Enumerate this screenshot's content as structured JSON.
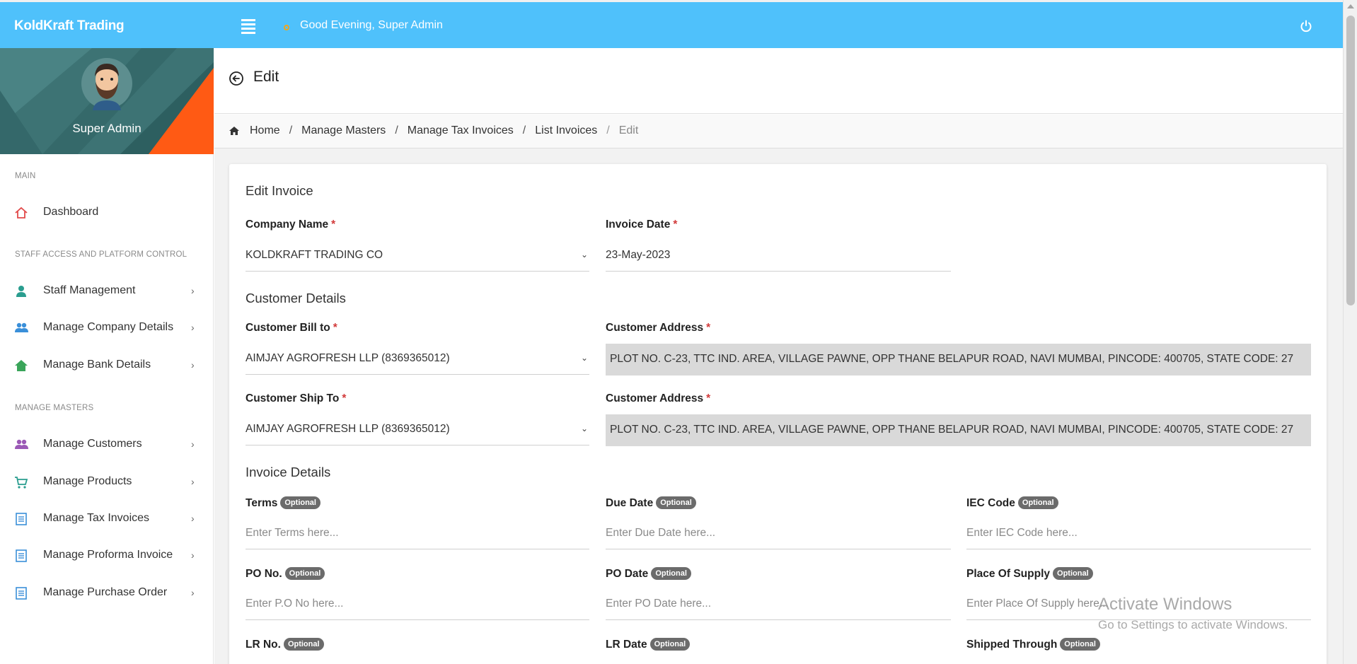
{
  "app": {
    "brand": "KoldKraft Trading",
    "greeting": "Good Evening, Super Admin"
  },
  "sidebar": {
    "profile_name": "Super Admin",
    "sections": [
      "MAIN",
      "STAFF ACCESS AND PLATFORM CONTROL",
      "MANAGE MASTERS"
    ],
    "items": [
      {
        "label": "Dashboard",
        "icon": "home-icon",
        "color": "#e24a4a"
      },
      {
        "label": "Staff Management",
        "icon": "user-icon",
        "color": "#2a9d8f"
      },
      {
        "label": "Manage Company Details",
        "icon": "users-icon",
        "color": "#3a8fd9"
      },
      {
        "label": "Manage Bank Details",
        "icon": "bank-home-icon",
        "color": "#3aa55a"
      },
      {
        "label": "Manage Customers",
        "icon": "customers-icon",
        "color": "#9b59b6"
      },
      {
        "label": "Manage Products",
        "icon": "cart-icon",
        "color": "#2a9d8f"
      },
      {
        "label": "Manage Tax Invoices",
        "icon": "document-icon",
        "color": "#3a8fd9"
      },
      {
        "label": "Manage Proforma Invoice",
        "icon": "document-icon",
        "color": "#3a8fd9"
      },
      {
        "label": "Manage Purchase Order",
        "icon": "document-icon",
        "color": "#3a8fd9"
      }
    ]
  },
  "page": {
    "title": "Edit",
    "breadcrumb": [
      "Home",
      "Manage Masters",
      "Manage Tax Invoices",
      "List Invoices",
      "Edit"
    ]
  },
  "form": {
    "card_title": "Edit Invoice",
    "company_name": {
      "label": "Company Name",
      "required": "*",
      "value": "KOLDKRAFT TRADING CO"
    },
    "invoice_date": {
      "label": "Invoice Date",
      "required": "*",
      "value": "23-May-2023"
    },
    "customer_details_title": "Customer Details",
    "bill_to": {
      "label": "Customer Bill to",
      "required": "*",
      "value": "AIMJAY AGROFRESH LLP (8369365012)"
    },
    "bill_address": {
      "label": "Customer Address",
      "required": "*",
      "value": "PLOT NO. C-23, TTC IND. AREA, VILLAGE PAWNE, OPP THANE BELAPUR ROAD, NAVI MUMBAI, PINCODE: 400705, STATE CODE: 27"
    },
    "ship_to": {
      "label": "Customer Ship To",
      "required": "*",
      "value": "AIMJAY AGROFRESH LLP (8369365012)"
    },
    "ship_address": {
      "label": "Customer Address",
      "required": "*",
      "value": "PLOT NO. C-23, TTC IND. AREA, VILLAGE PAWNE, OPP THANE BELAPUR ROAD, NAVI MUMBAI, PINCODE: 400705, STATE CODE: 27"
    },
    "invoice_details_title": "Invoice Details",
    "optional_badge": "Optional",
    "terms": {
      "label": "Terms",
      "placeholder": "Enter Terms here..."
    },
    "due_date": {
      "label": "Due Date",
      "placeholder": "Enter Due Date here..."
    },
    "iec_code": {
      "label": "IEC Code",
      "placeholder": "Enter IEC Code here..."
    },
    "po_no": {
      "label": "PO No.",
      "placeholder": "Enter P.O No here..."
    },
    "po_date": {
      "label": "PO Date",
      "placeholder": "Enter PO Date here..."
    },
    "place_of_supply": {
      "label": "Place Of Supply",
      "placeholder": "Enter Place Of Supply here..."
    },
    "lr_no": {
      "label": "LR No."
    },
    "lr_date": {
      "label": "LR Date"
    },
    "shipped_through": {
      "label": "Shipped Through"
    }
  },
  "watermark": {
    "line1": "Activate Windows",
    "line2": "Go to Settings to activate Windows."
  }
}
